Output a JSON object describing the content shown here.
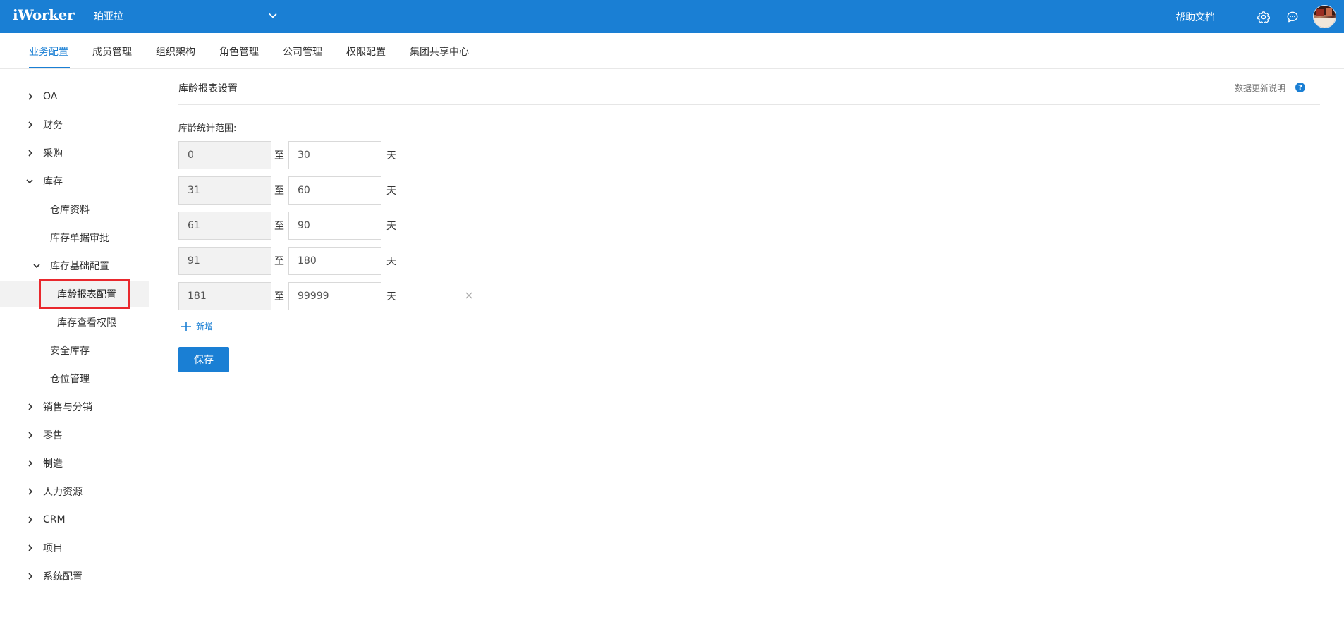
{
  "topbar": {
    "logo": "iWorker",
    "company": "珀亚拉",
    "help_docs": "帮助文档",
    "icons": [
      "chevron-down-icon",
      "gear-icon",
      "chat-icon",
      "avatar"
    ]
  },
  "tabs": [
    {
      "label": "业务配置",
      "active": true
    },
    {
      "label": "成员管理"
    },
    {
      "label": "组织架构"
    },
    {
      "label": "角色管理"
    },
    {
      "label": "公司管理"
    },
    {
      "label": "权限配置"
    },
    {
      "label": "集团共享中心"
    }
  ],
  "sidebar": {
    "items": [
      {
        "label": "OA"
      },
      {
        "label": "财务"
      },
      {
        "label": "采购"
      },
      {
        "label": "库存",
        "expanded": true
      },
      {
        "label": "仓库资料"
      },
      {
        "label": "库存单据审批"
      },
      {
        "label": "库存基础配置",
        "expanded": true
      },
      {
        "label": "库龄报表配置",
        "active": true
      },
      {
        "label": "库存查看权限"
      },
      {
        "label": "安全库存"
      },
      {
        "label": "仓位管理"
      },
      {
        "label": "销售与分销"
      },
      {
        "label": "零售"
      },
      {
        "label": "制造"
      },
      {
        "label": "人力资源"
      },
      {
        "label": "CRM"
      },
      {
        "label": "项目"
      },
      {
        "label": "系统配置"
      }
    ]
  },
  "main": {
    "title": "库龄报表设置",
    "data_note": "数据更新说明",
    "help_mark": "?",
    "range_label": "库龄统计范围:",
    "ranges": [
      {
        "from": "0",
        "to": "30"
      },
      {
        "from": "31",
        "to": "60"
      },
      {
        "from": "61",
        "to": "90"
      },
      {
        "from": "91",
        "to": "180"
      },
      {
        "from": "181",
        "to": "99999"
      }
    ],
    "to_text": "至",
    "unit": "天",
    "add_label": "新增",
    "save_label": "保存"
  },
  "colors": {
    "primary": "#1a7fd4",
    "highlight_border": "#e9282d",
    "active_bg": "#f2f2f2"
  }
}
